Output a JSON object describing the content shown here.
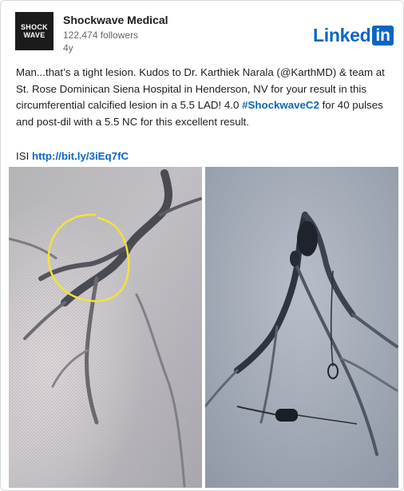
{
  "post": {
    "company_name": "Shockwave Medical",
    "followers": "122,474 followers",
    "age": "4y",
    "avatar_line1": "SHOCK",
    "avatar_line2": "WAVE",
    "linkedin_word": "Linked",
    "linkedin_box": "in",
    "body_part1": "Man...that’s a tight lesion. Kudos to Dr. Karthiek Narala (@KarthMD) & team at St. Rose Dominican Siena Hospital in Henderson, NV for your result in this circumferential calcified lesion in a 5.5 LAD! 4.0 ",
    "hashtag": "#ShockwaveC2",
    "body_part2": " for 40 pulses and post-dil with a 5.5 NC for this excellent result.",
    "isi_label": "ISI ",
    "isi_link": "http://bit.ly/3iEq7fC"
  },
  "colors": {
    "linkedin_blue": "#0a66c2",
    "annotation_yellow": "#f2e23a"
  },
  "images": [
    {
      "icon": "angiogram-with-yellow-circle-annotation"
    },
    {
      "icon": "angiogram-post-treatment"
    }
  ]
}
